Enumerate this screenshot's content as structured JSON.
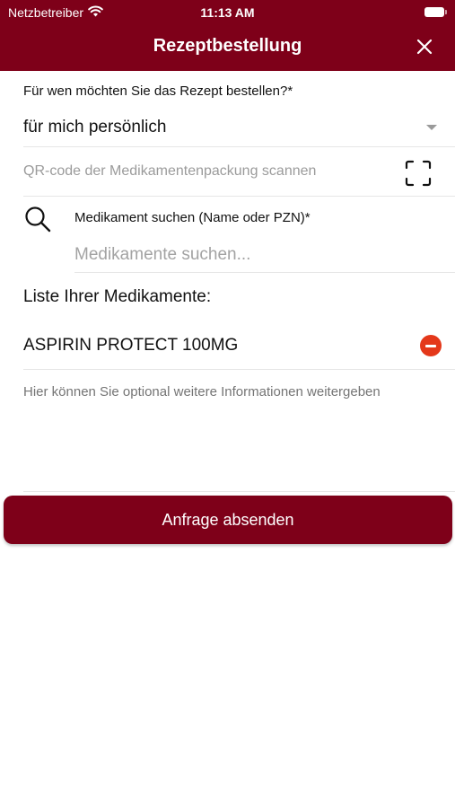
{
  "colors": {
    "brand": "#7e0019",
    "danger": "#e4381a"
  },
  "status_bar": {
    "carrier": "Netzbetreiber",
    "time": "11:13 AM",
    "icons": [
      "wifi-icon",
      "battery-icon"
    ]
  },
  "nav": {
    "title": "Rezeptbestellung",
    "close_icon": "close-icon"
  },
  "form": {
    "recipient_question": "Für wen möchten Sie das Rezept bestellen?*",
    "recipient_value": "für mich persönlich",
    "qr_label": "QR-code der Medikamentenpackung scannen",
    "qr_icon": "scan-frame-icon",
    "search_icon": "search-icon",
    "search_label": "Medikament suchen (Name oder PZN)*",
    "search_placeholder": "Medikamente suchen...",
    "search_value": "",
    "list_title": "Liste Ihrer Medikamente:",
    "medications": [
      {
        "name": "ASPIRIN PROTECT 100MG",
        "remove_icon": "minus-circle-icon"
      }
    ],
    "info_placeholder": "Hier können Sie optional weitere Informationen weitergeben",
    "submit_label": "Anfrage absenden"
  }
}
